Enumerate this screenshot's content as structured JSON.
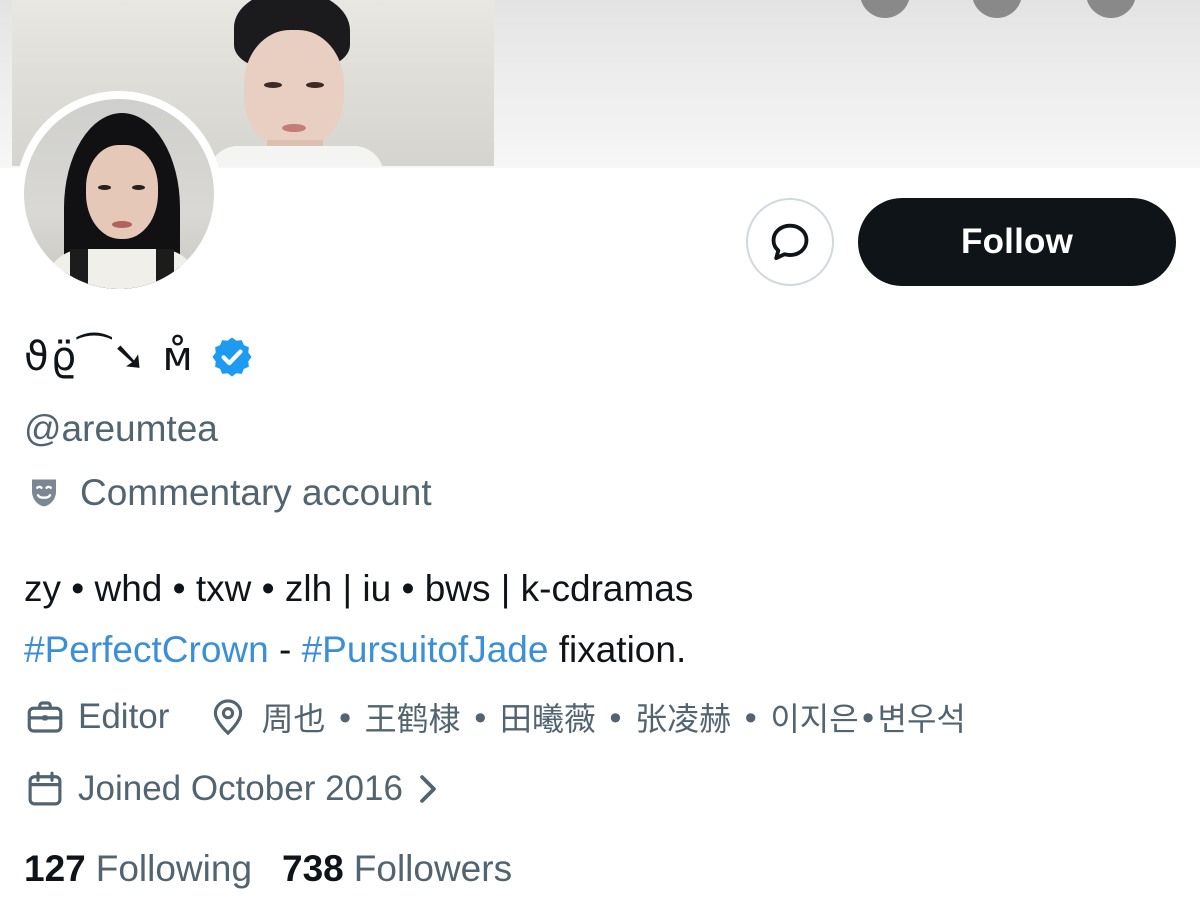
{
  "profile": {
    "display_name": "ϑϱ̈⁀➘ ᴍ̊",
    "handle": "@areumtea",
    "label": "Commentary account",
    "bio_line1": "zy • whd • txw • zlh | iu • bws | k-cdramas",
    "hashtag1": "#PerfectCrown",
    "bio_separator": " - ",
    "hashtag2": "#PursuitofJade",
    "bio_suffix": " fixation.",
    "profession": "Editor",
    "location": "周也 • 王鹤棣 • 田曦薇 • 张凌赫 • 이지은•변우석",
    "joined": "Joined October 2016"
  },
  "actions": {
    "follow_label": "Follow"
  },
  "stats": {
    "following_count": "127",
    "following_label": "Following",
    "followers_count": "738",
    "followers_label": "Followers"
  },
  "icons": {
    "message": "message-bubble-icon",
    "verified": "verified-badge-icon",
    "label": "theater-mask-icon",
    "profession": "briefcase-icon",
    "location": "location-pin-icon",
    "joined": "calendar-icon",
    "chevron": "chevron-right-icon"
  },
  "colors": {
    "verified_blue": "#1d9bf0",
    "hashtag_blue": "#3a8fd8",
    "secondary_text": "#536471",
    "follow_button": "#0f1419"
  }
}
